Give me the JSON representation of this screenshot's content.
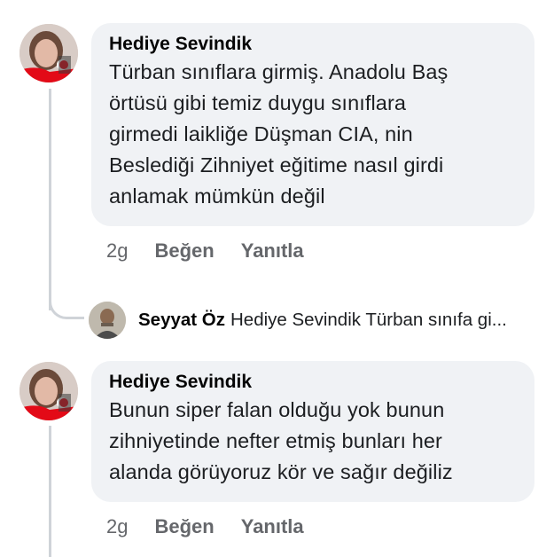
{
  "comments": [
    {
      "author": "Hediye Sevindik",
      "lines": [
        "Türban sınıflara girmiş. Anadolu Baş",
        "örtüsü gibi temiz duygu sınıflara",
        "girmedi laikliğe Düşman CIA, nin",
        "Beslediği Zihniyet eğitime nasıl girdi",
        "anlamak mümkün değil"
      ],
      "time": "2g",
      "like_label": "Beğen",
      "reply_label": "Yanıtla"
    },
    {
      "author": "Hediye Sevindik",
      "lines": [
        "Bunun siper falan olduğu yok bunun",
        "zihniyetinde nefter etmiş bunları  her",
        "alanda görüyoruz kör ve sağır değiliz"
      ],
      "time": "2g",
      "like_label": "Beğen",
      "reply_label": "Yanıtla"
    }
  ],
  "reply_preview": {
    "author": "Seyyat Öz",
    "text": "Hediye Sevindik Türban sınıfa gi..."
  },
  "colors": {
    "bubble": "#f0f2f5",
    "meta": "#65676b",
    "thread_line": "#cfd3d8",
    "flag_red": "#e30a17"
  }
}
